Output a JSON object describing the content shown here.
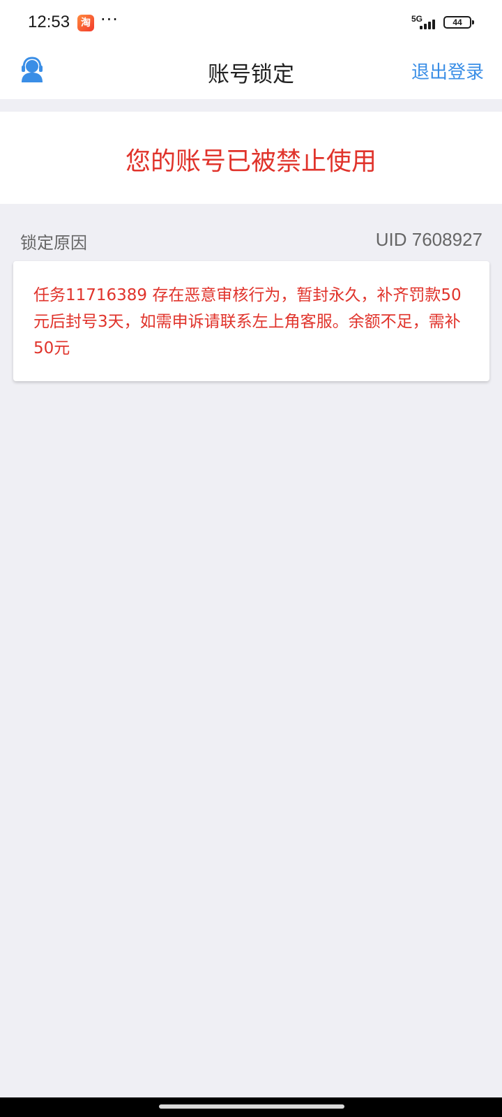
{
  "status_bar": {
    "time": "12:53",
    "app_badge": "淘",
    "dots": "···",
    "network": "5G",
    "battery": "44"
  },
  "nav": {
    "title": "账号锁定",
    "logout_label": "退出登录"
  },
  "ban": {
    "title": "您的账号已被禁止使用"
  },
  "reason": {
    "section_label": "锁定原因",
    "uid": "UID 7608927",
    "text": "任务11716389 存在恶意审核行为，暂封永久，补齐罚款50元后封号3天，如需申诉请联系左上角客服。余额不足，需补50元"
  },
  "colors": {
    "accent_blue": "#3a8ee6",
    "alert_red": "#e0332b",
    "background": "#efeff4"
  }
}
